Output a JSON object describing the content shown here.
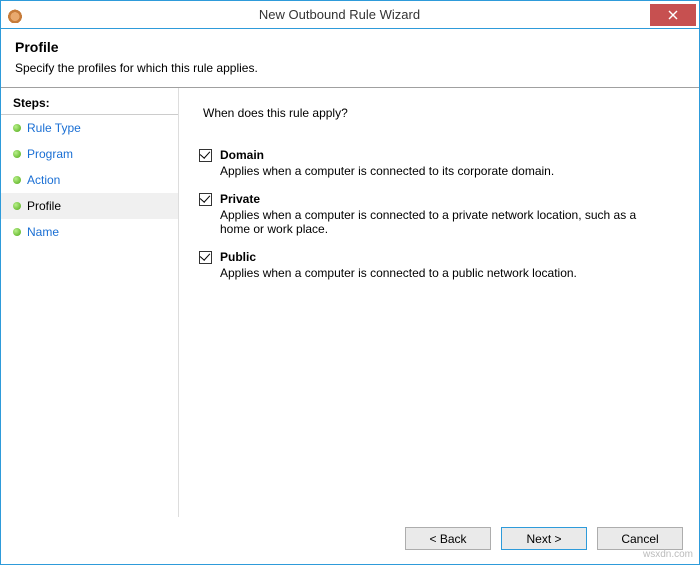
{
  "window": {
    "title": "New Outbound Rule Wizard"
  },
  "header": {
    "title": "Profile",
    "subtitle": "Specify the profiles for which this rule applies."
  },
  "sidebar": {
    "heading": "Steps:",
    "items": [
      {
        "label": "Rule Type",
        "current": false
      },
      {
        "label": "Program",
        "current": false
      },
      {
        "label": "Action",
        "current": false
      },
      {
        "label": "Profile",
        "current": true
      },
      {
        "label": "Name",
        "current": false
      }
    ]
  },
  "main": {
    "question": "When does this rule apply?",
    "options": [
      {
        "label": "Domain",
        "checked": true,
        "desc": "Applies when a computer is connected to its corporate domain."
      },
      {
        "label": "Private",
        "checked": true,
        "desc": "Applies when a computer is connected to a private network location, such as a home or work place."
      },
      {
        "label": "Public",
        "checked": true,
        "desc": "Applies when a computer is connected to a public network location."
      }
    ]
  },
  "footer": {
    "back": "< Back",
    "next": "Next >",
    "cancel": "Cancel"
  },
  "watermark": "wsxdn.com"
}
